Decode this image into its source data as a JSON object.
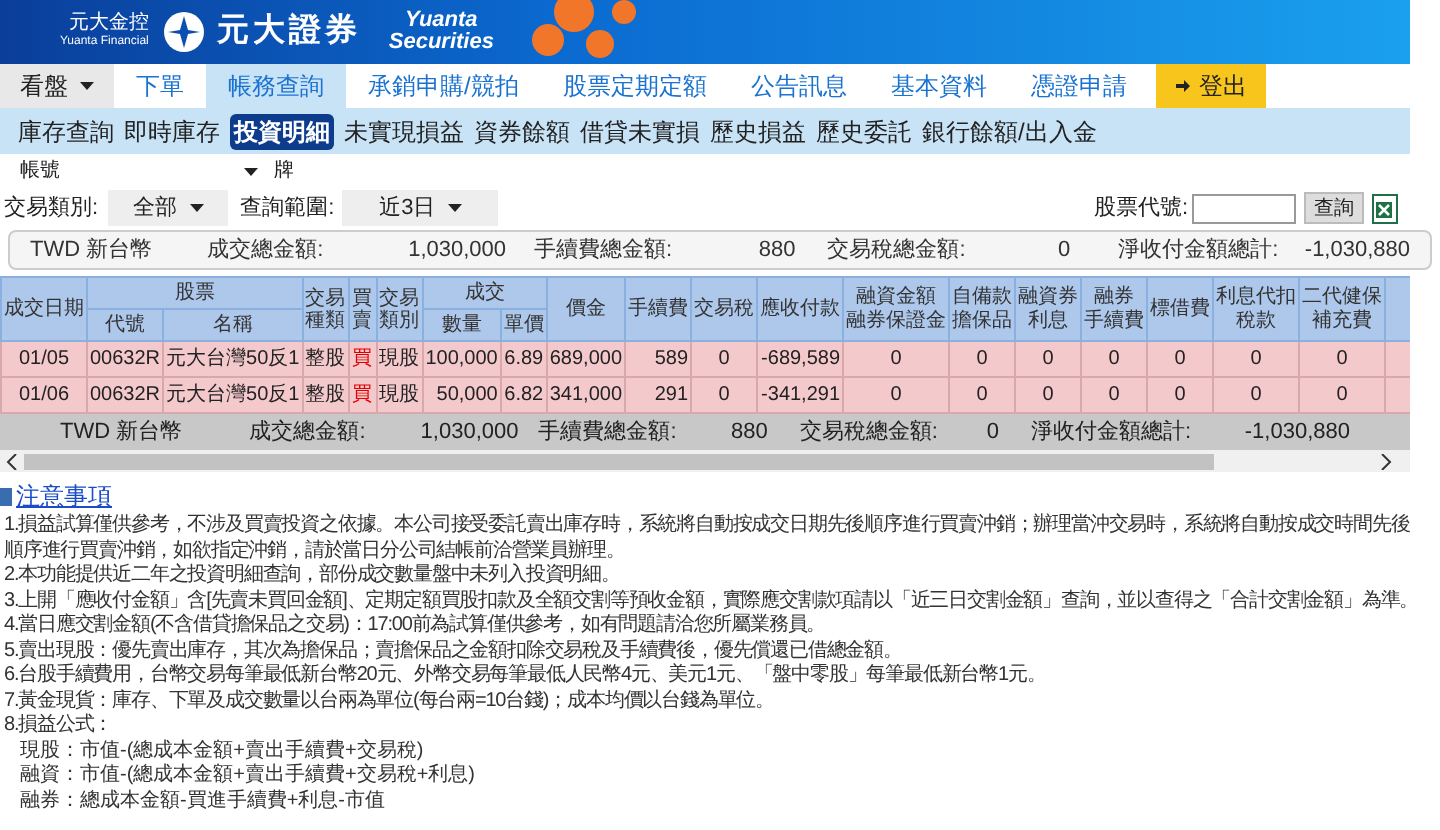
{
  "header": {
    "group_name": "元大金控",
    "group_name_en": "Yuanta Financial",
    "brand": "元大證券",
    "brand_en_top": "Yuanta",
    "brand_en_bottom": "Securities"
  },
  "nav": [
    {
      "label": "看盤",
      "kind": "dropdown",
      "selected": false
    },
    {
      "label": "下單",
      "kind": "tab",
      "selected": false
    },
    {
      "label": "帳務查詢",
      "kind": "tab",
      "selected": true
    },
    {
      "label": "承銷申購/競拍",
      "kind": "tab",
      "selected": false
    },
    {
      "label": "股票定期定額",
      "kind": "tab",
      "selected": false
    },
    {
      "label": "公告訊息",
      "kind": "tab",
      "selected": false
    },
    {
      "label": "基本資料",
      "kind": "tab",
      "selected": false
    },
    {
      "label": "憑證申請",
      "kind": "tab",
      "selected": false
    },
    {
      "label": "登出",
      "kind": "logout",
      "selected": false
    }
  ],
  "subnav": [
    {
      "label": "庫存查詢",
      "selected": false
    },
    {
      "label": "即時庫存",
      "selected": false
    },
    {
      "label": "投資明細",
      "selected": true
    },
    {
      "label": "未實現損益",
      "selected": false
    },
    {
      "label": "資券餘額",
      "selected": false
    },
    {
      "label": "借貸未實損",
      "selected": false
    },
    {
      "label": "歷史損益",
      "selected": false
    },
    {
      "label": "歷史委託",
      "selected": false
    },
    {
      "label": "銀行餘額/出入金",
      "selected": false
    }
  ],
  "account": {
    "label": "帳號",
    "suffix": "牌"
  },
  "filters": {
    "type_label": "交易類別:",
    "type_value": "全部",
    "range_label": "查詢範圍:",
    "range_value": "近3日",
    "code_label": "股票代號:",
    "query_button": "查詢"
  },
  "summary": {
    "currency": "TWD 新台幣",
    "total_label": "成交總金額:",
    "total": "1,030,000",
    "fee_label": "手續費總金額:",
    "fee": "880",
    "tax_label": "交易稅總金額:",
    "tax": "0",
    "net_label": "淨收付金額總計:",
    "net": "-1,030,880"
  },
  "table": {
    "group_headers": {
      "stock": "股票",
      "deal": "成交"
    },
    "columns": [
      "成交日期",
      "代號",
      "名稱",
      "交易種類",
      "買賣",
      "交易類別",
      "數量",
      "單價",
      "價金",
      "手續費",
      "交易稅",
      "應收付款",
      [
        "融資金額",
        "融券保證金"
      ],
      [
        "自備款",
        "擔保品"
      ],
      [
        "融資券",
        "利息"
      ],
      [
        "融券",
        "手續費"
      ],
      "標借費",
      [
        "利息代扣",
        "稅款"
      ],
      [
        "二代健保",
        "補充費"
      ]
    ],
    "rows": [
      [
        "01/05",
        "00632R",
        "元大台灣50反1",
        "整股",
        "買",
        "現股",
        "100,000",
        "6.89",
        "689,000",
        "589",
        "0",
        "-689,589",
        "0",
        "0",
        "0",
        "0",
        "0",
        "0",
        "0"
      ],
      [
        "01/06",
        "00632R",
        "元大台灣50反1",
        "整股",
        "買",
        "現股",
        "50,000",
        "6.82",
        "341,000",
        "291",
        "0",
        "-341,291",
        "0",
        "0",
        "0",
        "0",
        "0",
        "0",
        "0"
      ]
    ]
  },
  "footer_summary": {
    "currency": "TWD 新台幣",
    "total_label": "成交總金額:",
    "total": "1,030,000",
    "fee_label": "手續費總金額:",
    "fee": "880",
    "tax_label": "交易稅總金額:",
    "tax": "0",
    "net_label": "淨收付金額總計:",
    "net": "-1,030,880"
  },
  "notes": {
    "title": "注意事項",
    "lines": [
      "1.損益試算僅供參考，不涉及買賣投資之依據。本公司接受委託賣出庫存時，系統將自動按成交日期先後順序進行買賣沖銷；辦理當沖交易時，系統將自動按成交時間先後順序進行買賣沖銷，如欲指定沖銷，請於當日分公司結帳前洽營業員辦理。",
      "2.本功能提供近二年之投資明細查詢，部份成交數量盤中未列入投資明細。",
      "3.上開「應收付金額」含[先賣未買回金額]、定期定額買股扣款及全額交割等預收金額，實際應交割款項請以「近三日交割金額」查詢，並以查得之「合計交割金額」為準。",
      "4.當日應交割金額(不含借貸擔保品之交易)：17:00前為試算僅供參考，如有問題請洽您所屬業務員。",
      "5.賣出現股：優先賣出庫存，其次為擔保品；賣擔保品之金額扣除交易稅及手續費後，優先償還已借總金額。",
      "6.台股手續費用，台幣交易每筆最低新台幣20元、外幣交易每筆最低人民幣4元、美元1元、「盤中零股」每筆最低新台幣1元。",
      "7.黃金現貨：庫存、下單及成交數量以台兩為單位(每台兩=10台錢)；成本均價以台錢為單位。",
      "8.損益公式："
    ],
    "formulas": [
      "現股：市值-(總成本金額+賣出手續費+交易稅)",
      "融資：市值-(總成本金額+賣出手續費+交易稅+利息)",
      "融券：總成本金額-買進手續費+利息-市值"
    ]
  }
}
